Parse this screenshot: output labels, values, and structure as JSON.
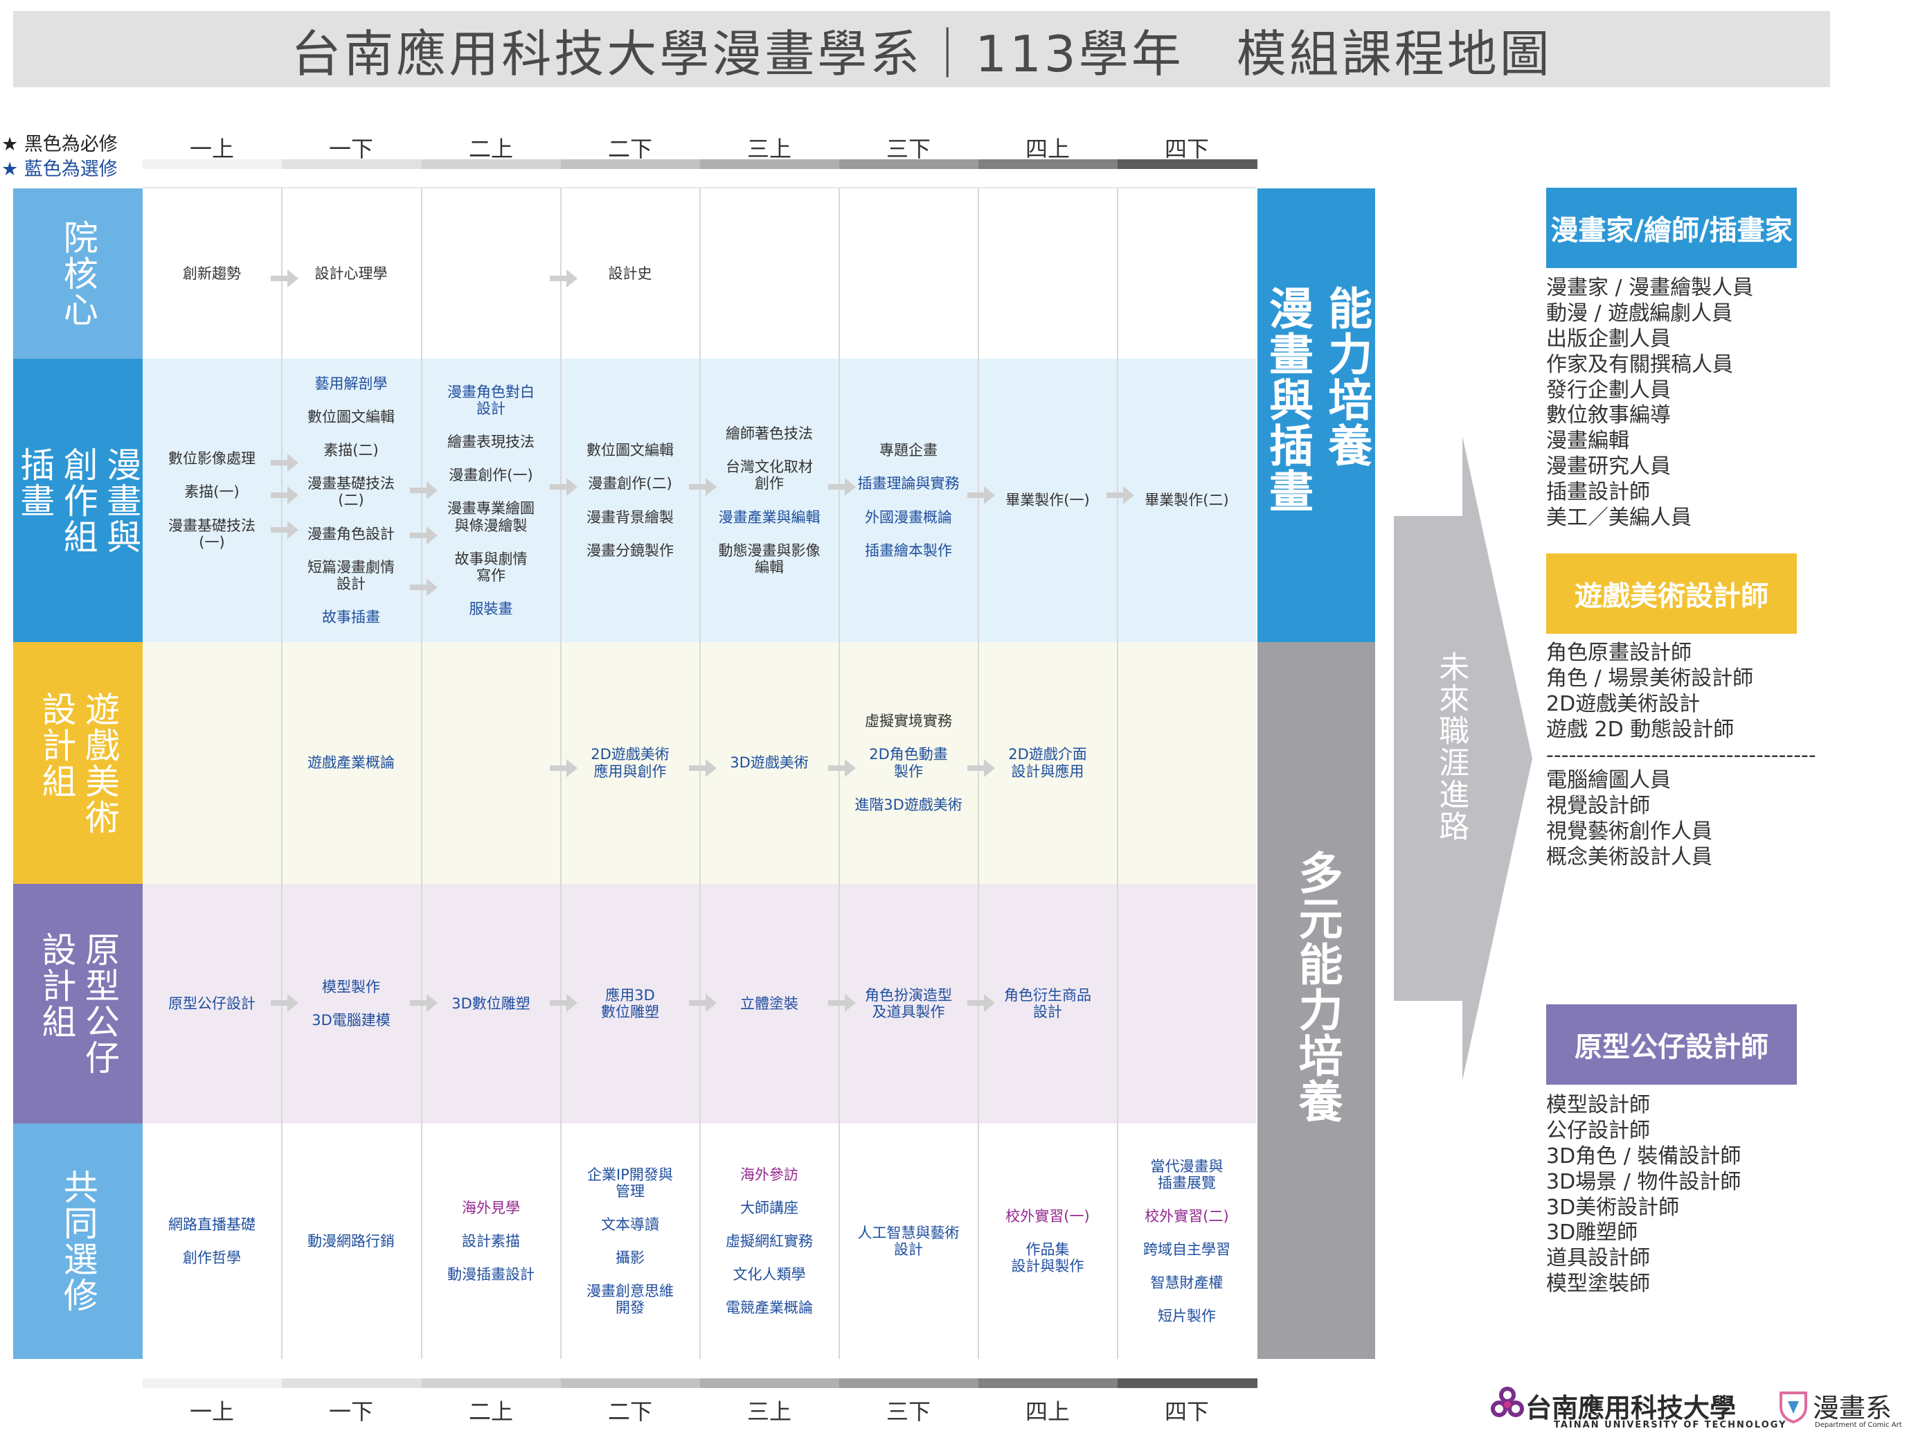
{
  "title": "台南應用科技大學漫畫學系｜113學年　模組課程地圖",
  "legend": {
    "required": "黑色為必修",
    "elective": "藍色為選修",
    "star_glyph": "★",
    "required_color": "#222222",
    "elective_color": "#1f4e9e"
  },
  "semesters": [
    "一上",
    "一下",
    "二上",
    "二下",
    "三上",
    "三下",
    "四上",
    "四下"
  ],
  "colors": {
    "row_core": "#6bb3e5",
    "row_comic": "#2d97d6",
    "row_game": "#f2c233",
    "row_proto": "#8178b5",
    "row_common": "#6bb3e5",
    "bg_comic": "#e3f1fa",
    "bg_game": "#f8f9ec",
    "bg_proto": "#f0e9f2",
    "side_blue": "#2d97d6",
    "side_gray": "#a0a0a4",
    "career_blue": "#2d97d6",
    "career_yellow": "#f2c233",
    "career_purple": "#8178b5",
    "elective_text": "#1f4e9e",
    "purple_text": "#93278f"
  },
  "rows": [
    {
      "key": "core",
      "label_cols": [
        "院核心"
      ],
      "cells": [
        {
          "courses": [
            {
              "t": "創新趨勢",
              "c": "r"
            }
          ]
        },
        {
          "courses": [
            {
              "t": "設計心理學",
              "c": "r"
            }
          ]
        },
        {
          "courses": []
        },
        {
          "courses": [
            {
              "t": "設計史",
              "c": "r"
            }
          ]
        },
        {
          "courses": []
        },
        {
          "courses": []
        },
        {
          "courses": []
        },
        {
          "courses": []
        }
      ]
    },
    {
      "key": "comic",
      "label_cols": [
        "漫畫與",
        "創作組",
        "插畫"
      ],
      "cells": [
        {
          "courses": [
            {
              "t": "數位影像處理",
              "c": "r"
            },
            {
              "t": "素描(一)",
              "c": "r"
            },
            {
              "t": "漫畫基礎技法\n(一)",
              "c": "r"
            }
          ]
        },
        {
          "courses": [
            {
              "t": "藝用解剖學",
              "c": "e"
            },
            {
              "t": "數位圖文編輯",
              "c": "r"
            },
            {
              "t": "素描(二)",
              "c": "r"
            },
            {
              "t": "漫畫基礎技法\n(二)",
              "c": "r"
            },
            {
              "t": "漫畫角色設計",
              "c": "r"
            },
            {
              "t": "短篇漫畫劇情\n設計",
              "c": "r"
            },
            {
              "t": "故事插畫",
              "c": "e"
            }
          ]
        },
        {
          "courses": [
            {
              "t": "漫畫角色對白\n設計",
              "c": "e"
            },
            {
              "t": "繪畫表現技法",
              "c": "r"
            },
            {
              "t": "漫畫創作(一)",
              "c": "r"
            },
            {
              "t": "漫畫專業繪圖\n與條漫繪製",
              "c": "r"
            },
            {
              "t": "故事與劇情\n寫作",
              "c": "r"
            },
            {
              "t": "服裝畫",
              "c": "e"
            }
          ]
        },
        {
          "courses": [
            {
              "t": "數位圖文編輯",
              "c": "r"
            },
            {
              "t": "漫畫創作(二)",
              "c": "r"
            },
            {
              "t": "漫畫背景繪製",
              "c": "r"
            },
            {
              "t": "漫畫分鏡製作",
              "c": "r"
            }
          ]
        },
        {
          "courses": [
            {
              "t": "繪師著色技法",
              "c": "r"
            },
            {
              "t": "台灣文化取材\n創作",
              "c": "r"
            },
            {
              "t": "漫畫產業與編輯",
              "c": "e"
            },
            {
              "t": "動態漫畫與影像\n編輯",
              "c": "r"
            }
          ]
        },
        {
          "courses": [
            {
              "t": "專題企畫",
              "c": "r"
            },
            {
              "t": "插畫理論與實務",
              "c": "e"
            },
            {
              "t": "外國漫畫概論",
              "c": "e"
            },
            {
              "t": "插畫繪本製作",
              "c": "e"
            }
          ]
        },
        {
          "courses": [
            {
              "t": "畢業製作(一)",
              "c": "r"
            }
          ]
        },
        {
          "courses": [
            {
              "t": "畢業製作(二)",
              "c": "r"
            }
          ]
        }
      ]
    },
    {
      "key": "game",
      "label_cols": [
        "遊戲美術",
        "設計組"
      ],
      "cells": [
        {
          "courses": []
        },
        {
          "courses": [
            {
              "t": "遊戲產業概論",
              "c": "e"
            }
          ]
        },
        {
          "courses": []
        },
        {
          "courses": [
            {
              "t": "2D遊戲美術\n應用與創作",
              "c": "e"
            }
          ]
        },
        {
          "courses": [
            {
              "t": "3D遊戲美術",
              "c": "e"
            }
          ]
        },
        {
          "courses": [
            {
              "t": "虛擬實境實務",
              "c": "r"
            },
            {
              "t": "2D角色動畫\n製作",
              "c": "e"
            },
            {
              "t": "進階3D遊戲美術",
              "c": "e"
            }
          ]
        },
        {
          "courses": [
            {
              "t": "2D遊戲介面\n設計與應用",
              "c": "e"
            }
          ]
        },
        {
          "courses": []
        }
      ]
    },
    {
      "key": "proto",
      "label_cols": [
        "原型公仔",
        "設計組"
      ],
      "cells": [
        {
          "courses": [
            {
              "t": "原型公仔設計",
              "c": "e"
            }
          ]
        },
        {
          "courses": [
            {
              "t": "模型製作",
              "c": "e"
            },
            {
              "t": "3D電腦建模",
              "c": "e"
            }
          ]
        },
        {
          "courses": [
            {
              "t": "3D數位雕塑",
              "c": "e"
            }
          ]
        },
        {
          "courses": [
            {
              "t": "應用3D\n數位雕塑",
              "c": "e"
            }
          ]
        },
        {
          "courses": [
            {
              "t": "立體塗裝",
              "c": "e"
            }
          ]
        },
        {
          "courses": [
            {
              "t": "角色扮演造型\n及道具製作",
              "c": "e"
            }
          ]
        },
        {
          "courses": [
            {
              "t": "角色衍生商品\n設計",
              "c": "e"
            }
          ]
        },
        {
          "courses": []
        }
      ]
    },
    {
      "key": "common",
      "label_cols": [
        "共同選修"
      ],
      "cells": [
        {
          "courses": [
            {
              "t": "網路直播基礎",
              "c": "e"
            },
            {
              "t": "創作哲學",
              "c": "e"
            }
          ]
        },
        {
          "courses": [
            {
              "t": "動漫網路行銷",
              "c": "e"
            }
          ]
        },
        {
          "courses": [
            {
              "t": "海外見學",
              "c": "p"
            },
            {
              "t": "設計素描",
              "c": "e"
            },
            {
              "t": "動漫插畫設計",
              "c": "e"
            }
          ]
        },
        {
          "courses": [
            {
              "t": "企業IP開發與\n管理",
              "c": "e"
            },
            {
              "t": "文本導讀",
              "c": "e"
            },
            {
              "t": "攝影",
              "c": "e"
            },
            {
              "t": "漫畫創意思維\n開發",
              "c": "e"
            }
          ]
        },
        {
          "courses": [
            {
              "t": "海外參訪",
              "c": "p"
            },
            {
              "t": "大師講座",
              "c": "e"
            },
            {
              "t": "虛擬網紅實務",
              "c": "e"
            },
            {
              "t": "文化人類學",
              "c": "e"
            },
            {
              "t": "電競產業概論",
              "c": "e"
            }
          ]
        },
        {
          "courses": [
            {
              "t": "人工智慧與藝術\n設計",
              "c": "e"
            }
          ]
        },
        {
          "courses": [
            {
              "t": "校外實習(一)",
              "c": "p"
            },
            {
              "t": "作品集\n設計與製作",
              "c": "e"
            }
          ]
        },
        {
          "courses": [
            {
              "t": "當代漫畫與\n插畫展覽",
              "c": "e"
            },
            {
              "t": "校外實習(二)",
              "c": "p"
            },
            {
              "t": "跨域自主學習",
              "c": "e"
            },
            {
              "t": "智慧財產權",
              "c": "e"
            },
            {
              "t": "短片製作",
              "c": "e"
            }
          ]
        }
      ]
    }
  ],
  "side_labels": {
    "top_cols": [
      "能力培養",
      "漫畫與插畫"
    ],
    "bottom_cols": [
      "多元能力培養"
    ]
  },
  "future_label": "未來職涯進路",
  "careers": [
    {
      "title": "漫畫家/繪師/插畫家",
      "items": [
        "漫畫家 / 漫畫繪製人員",
        "動漫 / 遊戲編劇人員",
        "出版企劃人員",
        "作家及有關撰稿人員",
        "發行企劃人員",
        "數位敘事編導",
        "漫畫編輯",
        "漫畫研究人員",
        "插畫設計師",
        "美工／美編人員"
      ]
    },
    {
      "title": "遊戲美術設計師",
      "items": [
        "角色原畫設計師",
        "角色 / 場景美術設計師",
        "2D遊戲美術設計",
        "遊戲 2D 動態設計師",
        "------------------------------------",
        "電腦繪圖人員",
        "視覺設計師",
        "視覺藝術創作人員",
        "概念美術設計人員"
      ]
    },
    {
      "title": "原型公仔設計師",
      "items": [
        "模型設計師",
        "公仔設計師",
        "3D角色 / 裝備設計師",
        "3D場景 / 物件設計師",
        "3D美術設計師",
        "3D雕塑師",
        "道具設計師",
        "模型塗裝師"
      ]
    }
  ],
  "footer": {
    "university": "台南應用科技大學",
    "university_en": "TAINAN UNIVERSITY OF TECHNOLOGY",
    "department": "漫畫系",
    "department_en": "Department of Comic Art"
  }
}
